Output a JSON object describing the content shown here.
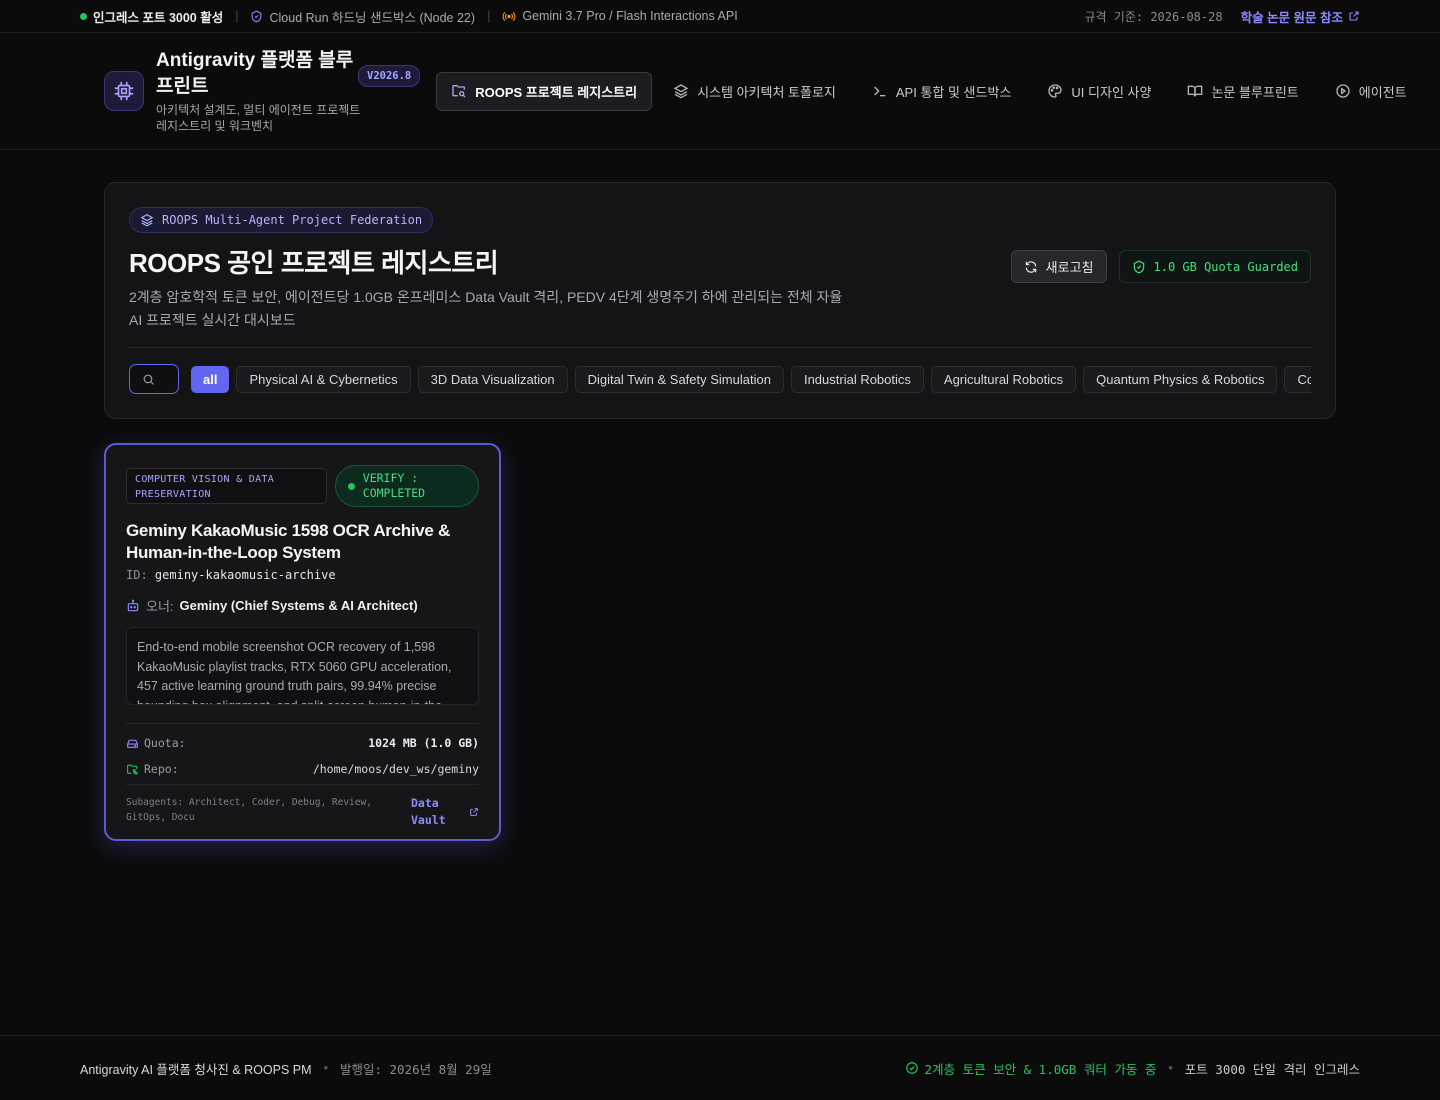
{
  "statusbar": {
    "ingress": "인그레스 포트 3000 활성",
    "sandbox": "Cloud Run 하드닝 샌드박스 (Node 22)",
    "model": "Gemini 3.7 Pro / Flash Interactions API",
    "spec_date": "규격 기준: 2026-08-28",
    "paper_link": "학술 논문 원문 참조"
  },
  "brand": {
    "title": "Antigravity 플랫폼 블루프린트",
    "subtitle": "아키텍처 설계도, 멀티 에이전트 프로젝트 레지스트리 및 워크벤치",
    "version": "V2026.8"
  },
  "nav": {
    "tabs": [
      {
        "label": "ROOPS 프로젝트 레지스트리",
        "icon": "folder-search-icon"
      },
      {
        "label": "시스템 아키텍처 토폴로지",
        "icon": "layers-icon"
      },
      {
        "label": "API 통합 및 샌드박스",
        "icon": "terminal-icon"
      },
      {
        "label": "UI 디자인 사양",
        "icon": "palette-icon"
      },
      {
        "label": "논문 블루프린트",
        "icon": "book-icon"
      },
      {
        "label": "에이전트",
        "icon": "play-circle-icon"
      }
    ]
  },
  "registry": {
    "federation_label": "ROOPS Multi-Agent Project Federation",
    "title": "ROOPS 공인 프로젝트 레지스트리",
    "description": "2계층 암호학적 토큰 보안, 에이전트당 1.0GB 온프레미스 Data Vault 격리, PEDV 4단계 생명주기 하에 관리되는 전체 자율 AI 프로젝트 실시간 대시보드",
    "refresh_label": "새로고침",
    "quota_label": "1.0 GB Quota Guarded",
    "search_placeholder": "",
    "filters": [
      "all",
      "Physical AI & Cybernetics",
      "3D Data Visualization",
      "Digital Twin & Safety Simulation",
      "Industrial Robotics",
      "Agricultural Robotics",
      "Quantum Physics & Robotics",
      "Comp"
    ]
  },
  "card": {
    "category": "COMPUTER VISION & DATA PRESERVATION",
    "verify": "VERIFY : COMPLETED",
    "title": "Geminy KakaoMusic 1598 OCR Archive & Human-in-the-Loop System",
    "id_label": "ID:",
    "id_value": "geminy-kakaomusic-archive",
    "owner_label": "오너:",
    "owner_value": "Geminy (Chief Systems & AI Architect)",
    "description": "End-to-end mobile screenshot OCR recovery of 1,598 KakaoMusic playlist tracks, RTX 5060 GPU acceleration, 457 active learning ground truth pairs, 99.94% precise bounding box alignment, and split-screen human-in-the-loop review.",
    "quota_label": "Quota:",
    "quota_value": "1024 MB (1.0 GB)",
    "repo_label": "Repo:",
    "repo_value": "/home/moos/dev_ws/geminy",
    "subagents": "Subagents: Architect, Coder, Debug, Review, GitOps, Docu",
    "vault_link": "Data Vault"
  },
  "footer": {
    "brand": "Antigravity AI 플랫폼 청사진 & ROOPS PM",
    "date": "발행일: 2026년 8월 29일",
    "security": "2계층 토큰 보안 & 1.0GB 쿼터 가동 중",
    "port": "포트 3000 단일 격리 인그레스"
  },
  "colors": {
    "accent": "#6366f1",
    "success": "#22c55e",
    "background": "#0b0b0c"
  }
}
